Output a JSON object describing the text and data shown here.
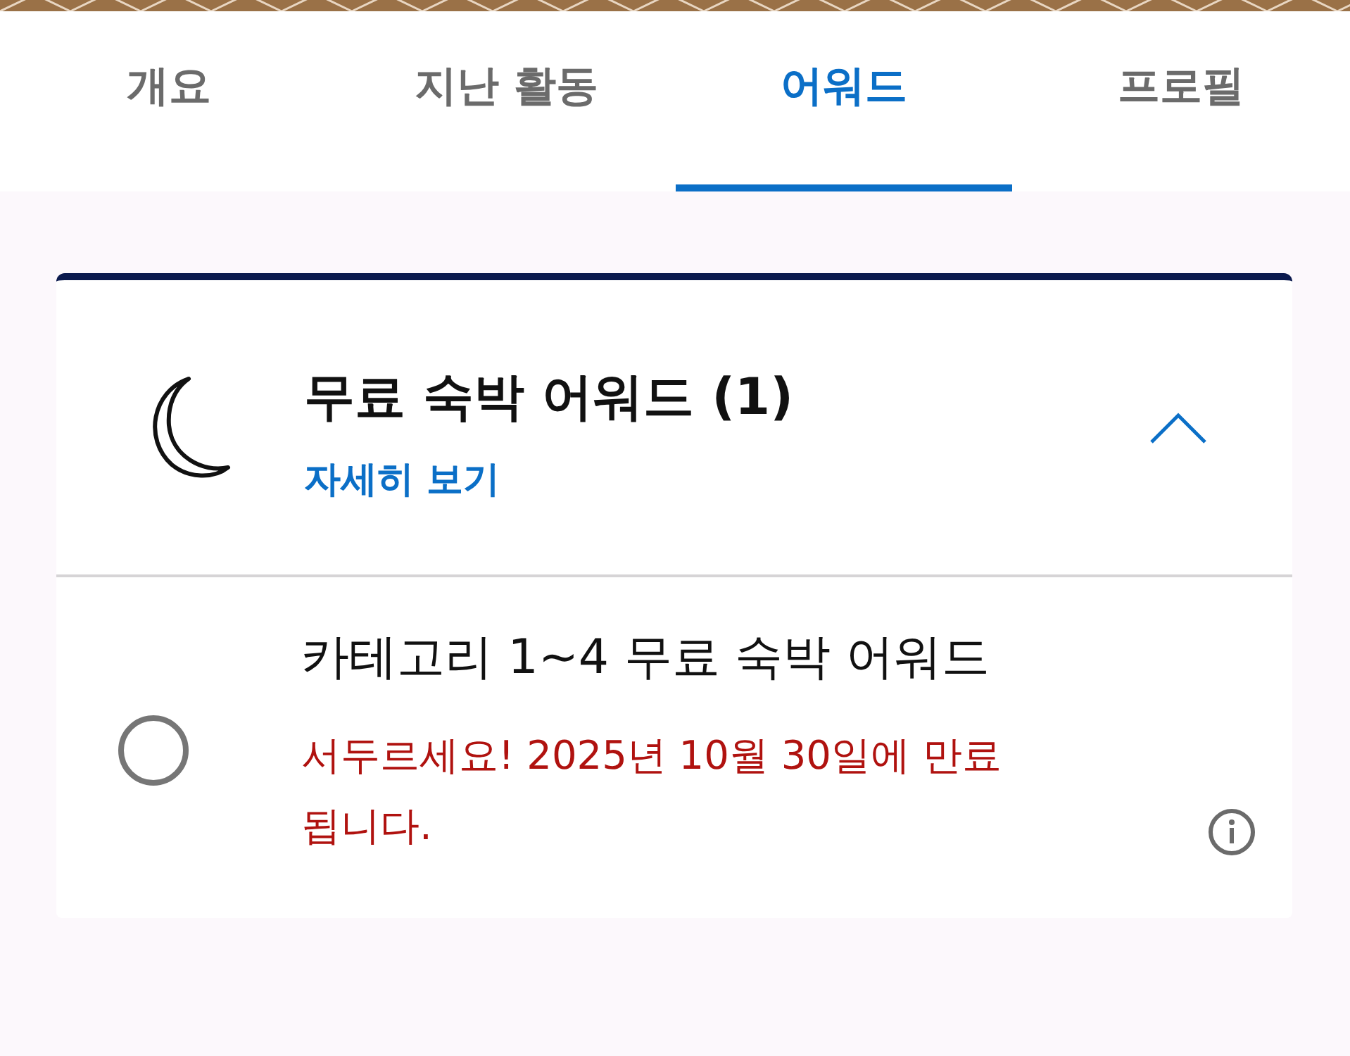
{
  "tabs": [
    {
      "label": "개요",
      "selected": false
    },
    {
      "label": "지난 활동",
      "selected": false
    },
    {
      "label": "어워드",
      "selected": true
    },
    {
      "label": "프로필",
      "selected": false
    }
  ],
  "award_section": {
    "title": "무료 숙박 어워드 (1)",
    "details_link": "자세히 보기",
    "expanded": true,
    "items": [
      {
        "title": "카테고리 1~4 무료 숙박 어워드",
        "expiry": "서두르세요! 2025년 10월 30일에 만료됩니다.",
        "selected": false
      }
    ]
  }
}
